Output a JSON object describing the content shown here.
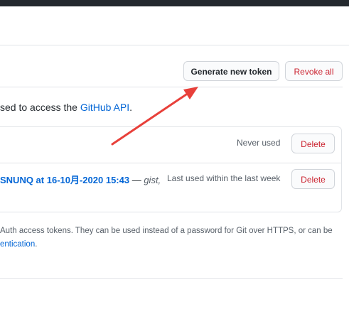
{
  "header": {
    "generate_label": "Generate new token",
    "revoke_all_label": "Revoke all"
  },
  "description": {
    "prefix": "sed to access the ",
    "link": "GitHub API",
    "suffix": "."
  },
  "tokens": [
    {
      "status": "Never used",
      "delete_label": "Delete"
    },
    {
      "name": "SNUNQ at 16-10月-2020 15:43",
      "separator": " — ",
      "scopes": "gist,",
      "status": "Last used within the last week",
      "delete_label": "Delete"
    }
  ],
  "footer": {
    "line1": "Auth access tokens. They can be used instead of a password for Git over HTTPS, or can be",
    "line2_link": "entication",
    "line2_suffix": "."
  },
  "annotation": {
    "color": "#e8403a"
  },
  "colors": {
    "link": "#0366d6",
    "danger": "#cb2431",
    "topbar": "#24292e"
  }
}
